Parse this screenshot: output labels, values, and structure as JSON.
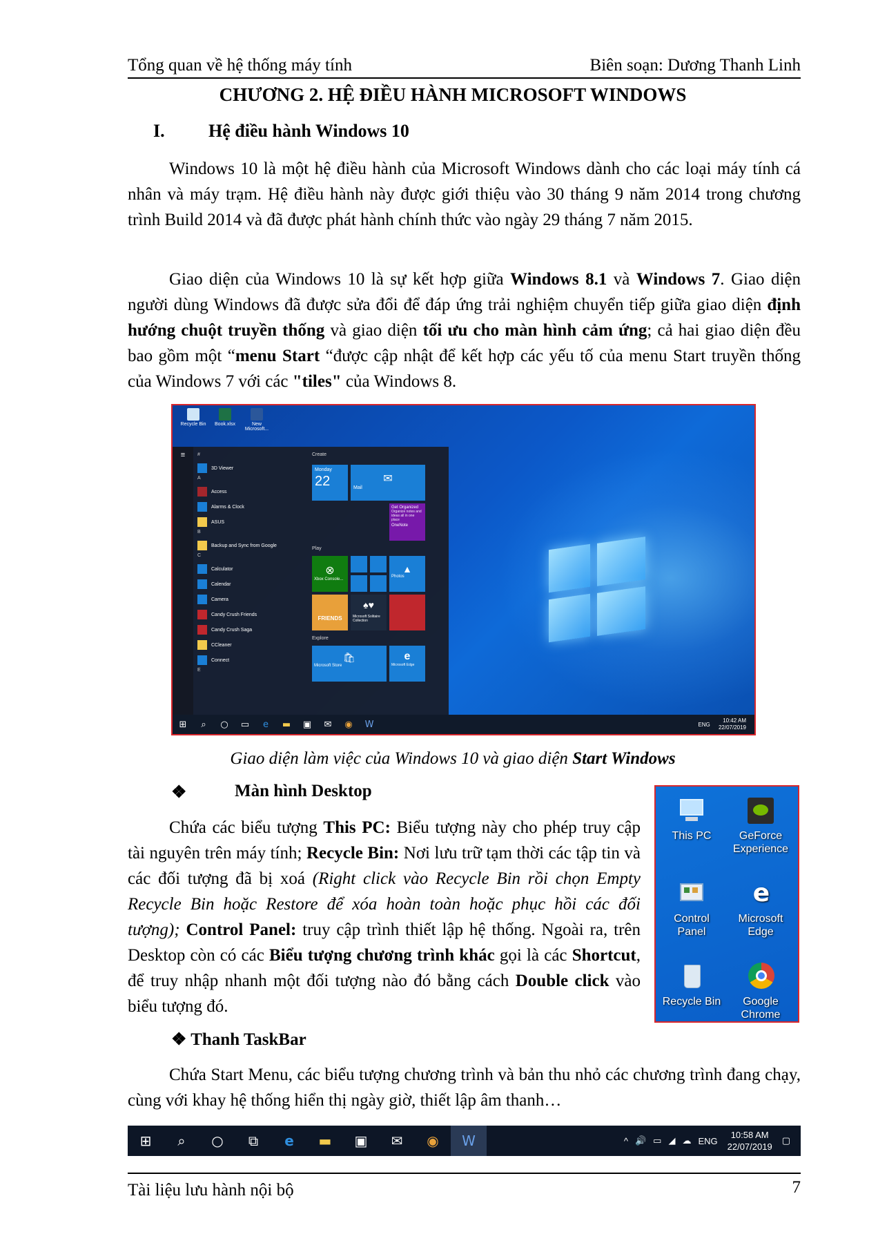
{
  "header": {
    "left": "Tổng quan về hệ thống máy tính",
    "right": "Biên soạn: Dương Thanh Linh"
  },
  "chapter_title": "CHƯƠNG 2. HỆ ĐIỀU HÀNH MICROSOFT WINDOWS",
  "section": {
    "number": "I.",
    "title": "Hệ điều hành Windows 10"
  },
  "intro": "Windows 10 là một hệ điều hành của Microsoft Windows dành cho các loại máy tính cá nhân và máy trạm. Hệ điều hành này được giới thiệu vào 30 tháng 9 năm 2014 trong chương trình Build 2014 và đã được phát hành chính thức vào ngày 29 tháng 7 năm 2015.",
  "p2": {
    "t1": "Giao diện của Windows 10 là sự kết hợp giữa ",
    "b1": "Windows 8.1",
    "t2": " và ",
    "b2": "Windows 7",
    "t3": ". Giao diện người dùng Windows đã được sửa đổi để đáp ứng trải nghiệm chuyển tiếp giữa giao diện ",
    "b3": "định hướng chuột truyền thống",
    "t4": " và giao diện ",
    "b4": "tối ưu cho màn hình cảm ứng",
    "t5": "; cả hai giao diện đều bao gồm một “",
    "b5": "menu Start",
    "t6": " “được cập nhật để kết hợp các yếu tố của menu Start truyền thống của Windows 7 với các ",
    "b6": "\"tiles\"",
    "t7": " của Windows 8."
  },
  "fig1": {
    "desktop_icons": [
      "Recycle Bin",
      "Book.xlsx",
      "New Microsoft..."
    ],
    "start_list": [
      {
        "h": "#"
      },
      {
        "app": "3D Viewer"
      },
      {
        "h": "A"
      },
      {
        "app": "Access"
      },
      {
        "app": "Alarms & Clock"
      },
      {
        "app": "ASUS"
      },
      {
        "h": "B"
      },
      {
        "app": "Backup and Sync from Google"
      },
      {
        "h": "C"
      },
      {
        "app": "Calculator"
      },
      {
        "app": "Calendar"
      },
      {
        "app": "Camera"
      },
      {
        "app": "Candy Crush Friends"
      },
      {
        "app": "Candy Crush Saga"
      },
      {
        "app": "CCleaner"
      },
      {
        "app": "Connect"
      },
      {
        "h": "E"
      }
    ],
    "groups": [
      "Create",
      "Play",
      "Explore"
    ],
    "tiles": {
      "calendar_day": "Monday",
      "calendar_date": "22",
      "mail": "Mail",
      "onenote_line1": "Get Organized",
      "onenote_line2": "Organize notes and ideas all in one place",
      "onenote": "OneNote",
      "xbox": "Xbox Console...",
      "photos": "Photos",
      "solitaire": "Microsoft Solitaire Collection",
      "friends": "FRIENDS",
      "store": "Microsoft Store",
      "edge": "Microsoft Edge"
    },
    "tray_lang": "ENG",
    "tray_time": "10:42 AM",
    "tray_date": "22/07/2019"
  },
  "fig1_caption": {
    "t1": "Giao diện làm việc của Windows 10 và giao diện ",
    "b1": "Start Windows"
  },
  "desktop_section": {
    "bullet": "❖",
    "title": "Màn hình Desktop",
    "t1": "Chứa các biểu tượng ",
    "b1": "This PC:",
    "t2": " Biểu tượng này cho phép truy cập tài nguyên trên máy tính; ",
    "b2": "Recycle Bin:",
    "t3": " Nơi lưu trữ tạm thời các tập tin và các đối tượng đã bị xoá ",
    "i1": "(Right click vào Recycle Bin rồi chọn Empty Recycle Bin hoặc Restore để xóa hoàn toàn hoặc phục hồi các đối tượng);",
    "t4": " ",
    "b3": "Control Panel:",
    "t5": " truy cập trình thiết lập hệ thống. Ngoài ra, trên Desktop còn có các ",
    "b4": "Biểu tượng chương trình khác",
    "t6": " gọi là các ",
    "b5": "Shortcut",
    "t7": ", để truy nhập nhanh một đối tượng nào đó bằng cách ",
    "b6": "Double click",
    "t8": " vào biểu tượng đó."
  },
  "fig2": {
    "this_pc": [
      "This PC"
    ],
    "geforce": [
      "GeForce",
      "Experience"
    ],
    "control_panel": [
      "Control",
      "Panel"
    ],
    "edge": [
      "Microsoft",
      "Edge"
    ],
    "recycle": [
      "Recycle Bin"
    ],
    "chrome": [
      "Google",
      "Chrome"
    ]
  },
  "taskbar_section": {
    "title": "❖ Thanh TaskBar",
    "text": "Chứa Start Menu, các biểu tượng chương trình và bản thu nhỏ các chương trình đang chạy, cùng với khay hệ thống hiển thị ngày giờ, thiết lập âm thanh…"
  },
  "taskbar": {
    "lang": "ENG",
    "time": "10:58 AM",
    "date": "22/07/2019"
  },
  "footer": {
    "left": "Tài liệu lưu hành nội bộ",
    "page": "7"
  }
}
